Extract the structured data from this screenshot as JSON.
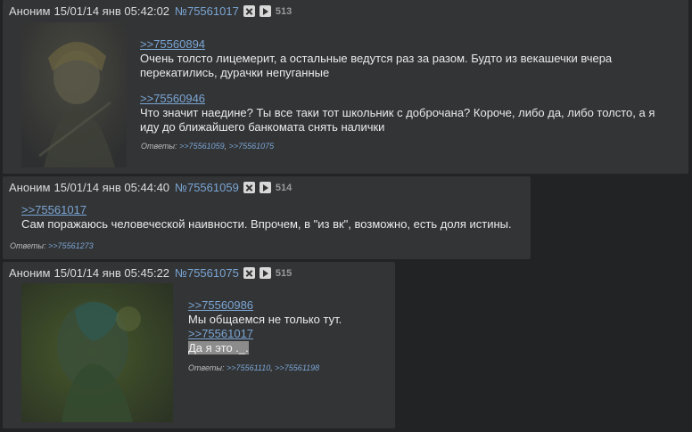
{
  "posts": [
    {
      "name": "Аноним",
      "date": "15/01/14 янв 05:42:02",
      "num": "№75561017",
      "index": "513",
      "blocks": [
        {
          "link": ">>75560894",
          "lines": [
            "Очень толсто лицемерит, а остальные ведутся раз за разом. Будто из векашечки вчера",
            "перекатились, дурачки непуганные"
          ]
        },
        {
          "link": ">>75560946",
          "lines": [
            "Что значит наедине? Ты все таки тот школьник с доброчана? Короче, либо да, либо толсто, а я",
            "иду до ближайшего банкомата снять налички"
          ]
        }
      ],
      "replies_label": "Ответы:",
      "replies": [
        ">>75561059",
        ">>75561075"
      ]
    },
    {
      "name": "Аноним",
      "date": "15/01/14 янв 05:44:40",
      "num": "№75561059",
      "index": "514",
      "blocks": [
        {
          "link": ">>75561017",
          "lines": [
            "Сам поражаюсь человеческой наивности. Впрочем, в \"из вк\", возможно, есть доля истины."
          ]
        }
      ],
      "replies_label": "Ответы:",
      "replies": [
        ">>75561273"
      ]
    },
    {
      "name": "Аноним",
      "date": "15/01/14 янв 05:45:22",
      "num": "№75561075",
      "index": "515",
      "blocks": [
        {
          "link": ">>75560986",
          "lines": [
            "Мы общаемся не только тут."
          ]
        },
        {
          "link": ">>75561017",
          "lines": [
            "Да я это ._."
          ]
        }
      ],
      "replies_label": "Ответы:",
      "replies": [
        ">>75561110",
        ">>75561198"
      ]
    }
  ],
  "colors": {
    "background": "#222324",
    "post_bg": "#333436",
    "link": "#7aa6d4",
    "text": "#eaeaea"
  }
}
